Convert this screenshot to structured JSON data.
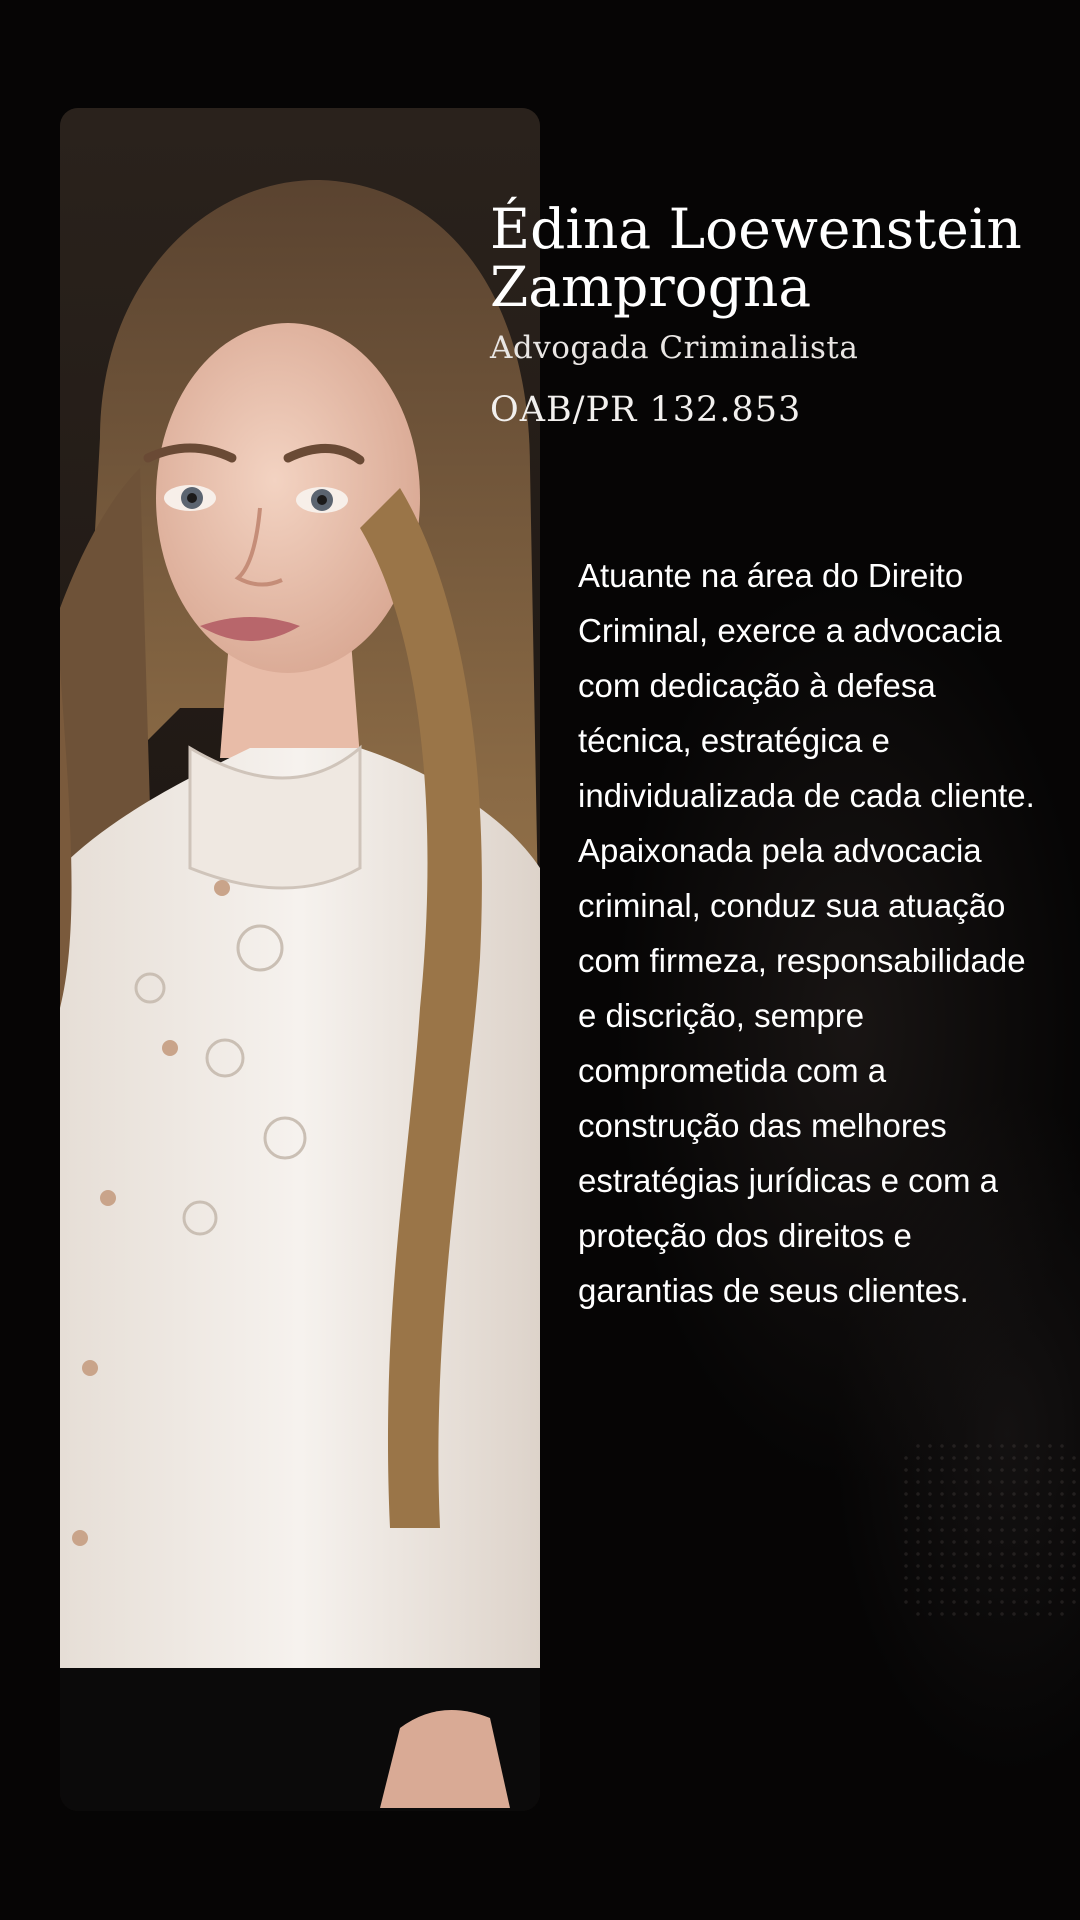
{
  "profile": {
    "name": "Édina Loewenstein Zamprogna",
    "role": "Advogada Criminalista",
    "oab": "OAB/PR 132.853"
  },
  "bio": {
    "text": "Atuante na área do Direito Criminal, exerce a advocacia com dedicação à defesa técnica, estratégica e individualizada de cada cliente. Apaixonada pela advocacia criminal, conduz sua atuação com firmeza, responsabilidade e discrição, sempre comprometida com a construção das melhores estratégias jurídicas e com a proteção dos direitos e garantias de seus clientes."
  },
  "colors": {
    "background": "#060505",
    "text": "#ffffff",
    "hair": "#8a6a45",
    "blouse": "#f1ece6"
  },
  "icons": {
    "portrait": "woman-portrait-photo"
  }
}
